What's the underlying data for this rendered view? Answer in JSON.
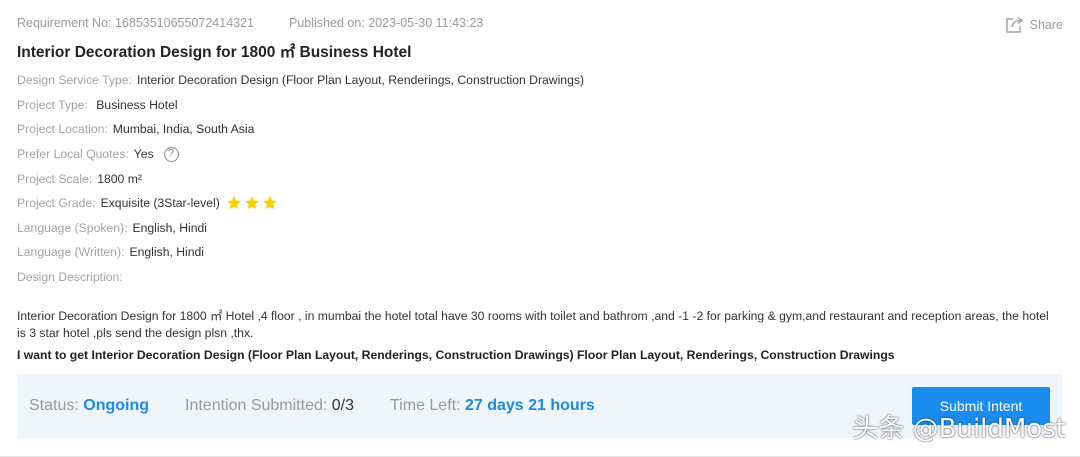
{
  "meta": {
    "requirement_no": "Requirement No: 16853510655072414321",
    "published_on": "Published on: 2023-05-30 11:43:23"
  },
  "share": {
    "label": "Share",
    "icon": "share-icon"
  },
  "title": "Interior Decoration Design for 1800 ㎡ Business Hotel",
  "fields": [
    {
      "label": "Design Service Type:",
      "value": "Interior Decoration Design (Floor Plan Layout, Renderings, Construction Drawings)"
    },
    {
      "label": "Project Type:",
      "value": " Business Hotel"
    },
    {
      "label": "Project Location:",
      "value": "Mumbai, India, South Asia"
    },
    {
      "label": "Prefer Local Quotes:",
      "value": "Yes"
    },
    {
      "label": "Project Scale:",
      "value": "1800 m²"
    },
    {
      "label": "Project Grade:",
      "value": "Exquisite (3Star-level)"
    },
    {
      "label": "Language (Spoken):",
      "value": "English, Hindi"
    },
    {
      "label": "Language (Written):",
      "value": "English, Hindi"
    },
    {
      "label": "Design Description:",
      "value": ""
    }
  ],
  "help_icon_glyph": "?",
  "stars": {
    "count": 3,
    "color": "#f5d20a"
  },
  "description": "Interior Decoration Design for 1800 ㎡ Hotel ,4 floor , in mumbai the hotel total have 30 rooms with toilet and bathrom ,and -1 -2 for parking & gym,and restaurant and reception areas, the hotel is 3 star hotel ,pls send the design plsn ,thx.",
  "want": "I want to get Interior Decoration Design (Floor Plan Layout, Renderings, Construction Drawings) Floor Plan Layout, Renderings, Construction Drawings",
  "status_bar": {
    "status_label": "Status: ",
    "status_value": "Ongoing",
    "intent_label": "Intention Submitted: ",
    "intent_value": "0",
    "intent_total": "/3",
    "time_label": "Time Left: ",
    "time_value": "27 days 21 hours",
    "submit_label": "Submit Intent"
  },
  "watermark": "头条 @BuildMost",
  "colors": {
    "accent": "#1e8ae6",
    "button": "#1a8cf0",
    "status_bg": "#eef5fb",
    "label_gray": "#a3a3a3"
  }
}
